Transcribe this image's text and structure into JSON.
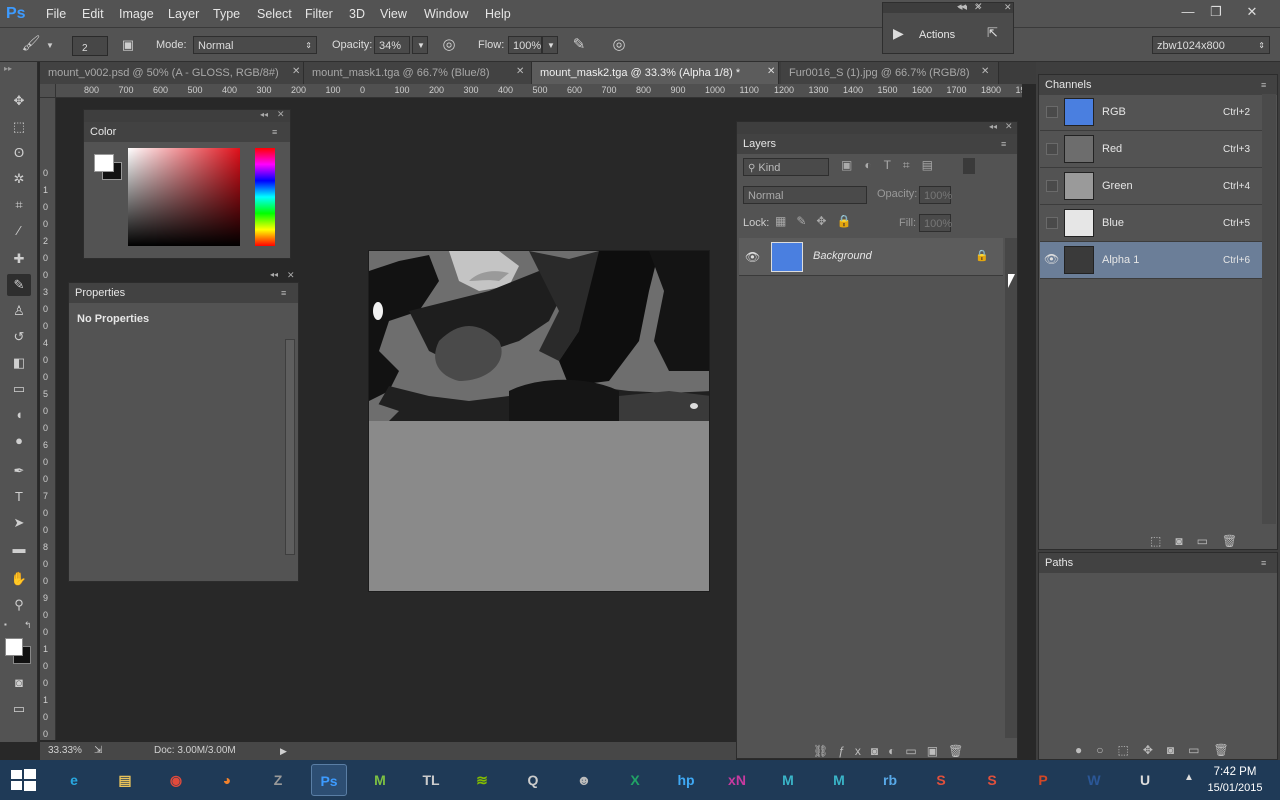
{
  "app": {
    "logo": "Ps"
  },
  "menu": [
    "File",
    "Edit",
    "Image",
    "Layer",
    "Type",
    "Select",
    "Filter",
    "3D",
    "View",
    "Window",
    "Help"
  ],
  "window_controls": {
    "minimize": "—",
    "maximize": "❐",
    "close": "✕"
  },
  "options": {
    "brush_size": "2",
    "mode_label": "Mode:",
    "mode_value": "Normal",
    "opacity_label": "Opacity:",
    "opacity_value": "34%",
    "flow_label": "Flow:",
    "flow_value": "100%",
    "workspace": "zbw1024x800"
  },
  "actions_panel": {
    "label": "Actions"
  },
  "tabs": [
    {
      "label": "mount_v002.psd @ 50% (A - GLOSS, RGB/8#)"
    },
    {
      "label": "mount_mask1.tga @ 66.7% (Blue/8)"
    },
    {
      "label": "mount_mask2.tga @ 33.3% (Alpha 1/8) *"
    },
    {
      "label": "Fur0016_S (1).jpg @ 66.7% (RGB/8)"
    }
  ],
  "ruler_ticks": [
    "800",
    "700",
    "600",
    "500",
    "400",
    "300",
    "200",
    "100",
    "0",
    "100",
    "200",
    "300",
    "400",
    "500",
    "600",
    "700",
    "800",
    "900",
    "1000",
    "1100",
    "1200",
    "1300",
    "1400",
    "1500",
    "1600",
    "1700",
    "1800",
    "19"
  ],
  "vruler_ticks": [
    "0",
    "1",
    "0",
    "0",
    "2",
    "0",
    "0",
    "3",
    "0",
    "0",
    "4",
    "0",
    "0",
    "5",
    "0",
    "0",
    "6",
    "0",
    "0",
    "7",
    "0",
    "0",
    "8",
    "0",
    "0",
    "9",
    "0",
    "0",
    "1",
    "0",
    "0",
    "1",
    "0",
    "0"
  ],
  "color_panel": {
    "title": "Color"
  },
  "properties_panel": {
    "title": "Properties",
    "message": "No Properties"
  },
  "layers_panel": {
    "title": "Layers",
    "filter_placeholder": "Kind",
    "blend_mode": "Normal",
    "opacity_label": "Opacity:",
    "opacity_value": "100%",
    "lock_label": "Lock:",
    "fill_label": "Fill:",
    "fill_value": "100%",
    "layers": [
      {
        "name": "Background"
      }
    ]
  },
  "channels_panel": {
    "title": "Channels",
    "channels": [
      {
        "name": "RGB",
        "shortcut": "Ctrl+2",
        "thumb": "#4a7fe0"
      },
      {
        "name": "Red",
        "shortcut": "Ctrl+3",
        "thumb": "#6d6d6d"
      },
      {
        "name": "Green",
        "shortcut": "Ctrl+4",
        "thumb": "#9a9a9a"
      },
      {
        "name": "Blue",
        "shortcut": "Ctrl+5",
        "thumb": "#e6e6e6"
      },
      {
        "name": "Alpha 1",
        "shortcut": "Ctrl+6",
        "thumb": "#3a3a3a"
      }
    ]
  },
  "paths_panel": {
    "title": "Paths"
  },
  "status_bar": {
    "zoom": "33.33%",
    "doc": "Doc: 3.00M/3.00M"
  },
  "taskbar": {
    "time": "7:42 PM",
    "date": "15/01/2015",
    "apps": [
      {
        "name": "ie",
        "glyph": "e",
        "color": "#29a8e0"
      },
      {
        "name": "explorer",
        "glyph": "▤",
        "color": "#e8c25a"
      },
      {
        "name": "chrome",
        "glyph": "◉",
        "color": "#e24a3b"
      },
      {
        "name": "firefox",
        "glyph": "◕",
        "color": "#f2822c"
      },
      {
        "name": "zbrush",
        "glyph": "Z",
        "color": "#9a9a9a"
      },
      {
        "name": "photoshop",
        "glyph": "Ps",
        "color": "#3d9bff"
      },
      {
        "name": "mudbox",
        "glyph": "M",
        "color": "#7dc243"
      },
      {
        "name": "tl",
        "glyph": "TL",
        "color": "#cccccc"
      },
      {
        "name": "spotify",
        "glyph": "≋",
        "color": "#84bd00"
      },
      {
        "name": "unfold",
        "glyph": "Q",
        "color": "#cccccc"
      },
      {
        "name": "marmoset",
        "glyph": "☻",
        "color": "#bbbbbb"
      },
      {
        "name": "excel",
        "glyph": "X",
        "color": "#21a366"
      },
      {
        "name": "hp",
        "glyph": "hp",
        "color": "#3fa9f5"
      },
      {
        "name": "xn",
        "glyph": "xN",
        "color": "#c83aa0"
      },
      {
        "name": "maya-lt",
        "glyph": "M",
        "color": "#3ab5c8"
      },
      {
        "name": "maya",
        "glyph": "M",
        "color": "#3ab5c8"
      },
      {
        "name": "rb",
        "glyph": "rb",
        "color": "#58a9e8"
      },
      {
        "name": "substance-designer",
        "glyph": "S",
        "color": "#e0503c"
      },
      {
        "name": "substance-painter",
        "glyph": "S",
        "color": "#e0503c"
      },
      {
        "name": "powerpoint",
        "glyph": "P",
        "color": "#d24726"
      },
      {
        "name": "word",
        "glyph": "W",
        "color": "#2b5797"
      },
      {
        "name": "unreal",
        "glyph": "U",
        "color": "#dddddd"
      }
    ]
  }
}
